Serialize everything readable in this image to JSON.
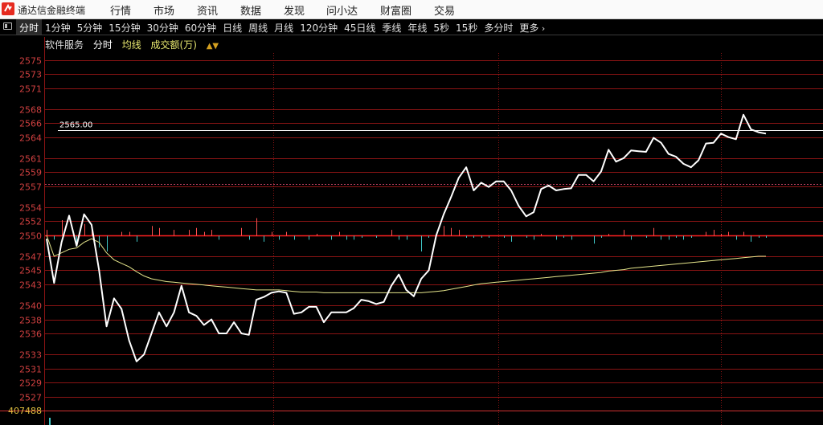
{
  "app": {
    "title": "通达信金融终端"
  },
  "menu": [
    "行情",
    "市场",
    "资讯",
    "数据",
    "发现",
    "问小达",
    "财富圈",
    "交易"
  ],
  "periods": [
    "分时",
    "1分钟",
    "5分钟",
    "15分钟",
    "30分钟",
    "60分钟",
    "日线",
    "周线",
    "月线",
    "120分钟",
    "45日线",
    "季线",
    "年线",
    "5秒",
    "15秒",
    "多分时",
    "更多"
  ],
  "active_period": "分时",
  "chart_header": {
    "stock_name": "软件服务",
    "mode": "分时",
    "ma_label": "均线",
    "volume_label": "成交额(万)",
    "sort_icon": "sort-icon"
  },
  "colors": {
    "background": "#000000",
    "grid": "#8a1414",
    "axis_text": "#d04040",
    "price_line": "#ffffff",
    "avg_line": "#e6e68c",
    "up_bar": "#ff5050",
    "down_bar": "#40c8c8",
    "menubar_bg": "#fafafa"
  },
  "chart_data": {
    "type": "line",
    "ylim": [
      2525,
      2576
    ],
    "yticks": [
      "2575",
      "2573",
      "2571",
      "2568",
      "2566",
      "2564",
      "2561",
      "2559",
      "2557",
      "2554",
      "2552",
      "2550",
      "2547",
      "2545",
      "2543",
      "2540",
      "2538",
      "2536",
      "2533",
      "2531",
      "2529",
      "2527"
    ],
    "reference_price": 2550,
    "annotation": {
      "label": "2565.00",
      "value": 2565
    },
    "volume_axis_label": "407488",
    "series": [
      {
        "values": [
          2549.5,
          2543.2,
          2549,
          2552.8,
          2548.5,
          2553,
          2551.5,
          2545,
          2537,
          2541,
          2539.5,
          2535,
          2532,
          2533,
          2536,
          2539,
          2537,
          2539,
          2542.8,
          2539,
          2538.5,
          2537.2,
          2538,
          2536,
          2536,
          2537.6,
          2536,
          2535.8,
          2540.8,
          2541.2,
          2541.8,
          2542,
          2541.8,
          2538.8,
          2539,
          2539.8,
          2539.8,
          2537.6,
          2539,
          2539,
          2539,
          2539.6,
          2540.8,
          2540.6,
          2540.2,
          2540.5,
          2542.8,
          2544.4,
          2542.2,
          2541.3,
          2543.8,
          2545,
          2550,
          2553,
          2555.5,
          2558.2,
          2559.7,
          2556.4,
          2557.5,
          2556.9,
          2557.7,
          2557.7,
          2556.4,
          2554.2,
          2552.7,
          2553.3,
          2556.6,
          2557.1,
          2556.4,
          2556.6,
          2556.7,
          2558.6,
          2558.6,
          2557.7,
          2559.1,
          2562.2,
          2560.5,
          2561,
          2562.1,
          2562,
          2561.9,
          2563.9,
          2563.2,
          2561.6,
          2561.2,
          2560.2,
          2559.7,
          2560.7,
          2563.1,
          2563.2,
          2564.5,
          2564,
          2563.7,
          2567.2,
          2565.1,
          2564.7,
          2564.5
        ]
      },
      {
        "values": [
          2550,
          2547,
          2547.5,
          2548,
          2548.2,
          2549,
          2549.5,
          2549,
          2547.5,
          2546.5,
          2546,
          2545.5,
          2544.8,
          2544.2,
          2543.8,
          2543.6,
          2543.4,
          2543.3,
          2543.2,
          2543.1,
          2543,
          2542.9,
          2542.8,
          2542.7,
          2542.6,
          2542.5,
          2542.4,
          2542.3,
          2542.2,
          2542.2,
          2542.2,
          2542.2,
          2542.1,
          2542,
          2541.9,
          2541.9,
          2541.9,
          2541.8,
          2541.8,
          2541.8,
          2541.8,
          2541.8,
          2541.8,
          2541.8,
          2541.8,
          2541.8,
          2541.8,
          2541.8,
          2541.8,
          2541.8,
          2541.8,
          2541.9,
          2542,
          2542.1,
          2542.3,
          2542.5,
          2542.7,
          2542.9,
          2543.1,
          2543.2,
          2543.3,
          2543.4,
          2543.5,
          2543.6,
          2543.7,
          2543.8,
          2543.9,
          2544,
          2544.1,
          2544.2,
          2544.3,
          2544.4,
          2544.5,
          2544.6,
          2544.7,
          2544.9,
          2545,
          2545.1,
          2545.3,
          2545.4,
          2545.5,
          2545.6,
          2545.7,
          2545.8,
          2545.9,
          2546,
          2546.1,
          2546.2,
          2546.3,
          2546.4,
          2546.5,
          2546.6,
          2546.7,
          2546.8,
          2546.9,
          2547,
          2547
        ]
      }
    ],
    "volume_bars": [
      3,
      -2,
      8,
      0,
      -4,
      6,
      3,
      -6,
      -8,
      0,
      2,
      2,
      -3,
      0,
      5,
      4,
      0,
      3,
      0,
      3,
      4,
      2,
      3,
      -2,
      0,
      0,
      4,
      -2,
      9,
      -3,
      2,
      -2,
      2,
      -2,
      0,
      -2,
      1,
      0,
      -2,
      2,
      -2,
      -2,
      -1,
      0,
      -1,
      0,
      3,
      -2,
      -2,
      0,
      -8,
      -1,
      1,
      5,
      4,
      3,
      -1,
      -1,
      -1,
      -1,
      0,
      -1,
      -3,
      0,
      -1,
      -2,
      1,
      0,
      -2,
      -1,
      -2,
      0,
      0,
      -4,
      -1,
      1,
      0,
      3,
      -2,
      0,
      -1,
      4,
      -2,
      -2,
      -1,
      -2,
      -1,
      0,
      2,
      3,
      1,
      2,
      -2,
      2,
      -3,
      -1,
      -1
    ]
  }
}
